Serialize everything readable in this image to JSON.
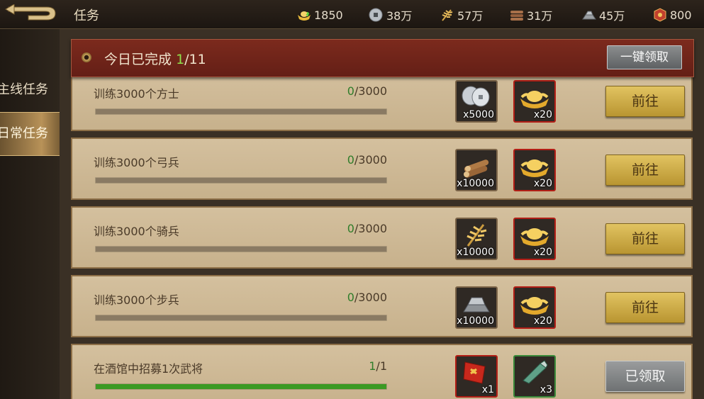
{
  "topbar": {
    "title": "任务",
    "resources": [
      {
        "icon": "gold-ingot-icon",
        "value": "1850"
      },
      {
        "icon": "silver-coin-icon",
        "value": "38万"
      },
      {
        "icon": "grain-icon",
        "value": "57万"
      },
      {
        "icon": "wood-icon",
        "value": "31万"
      },
      {
        "icon": "iron-icon",
        "value": "45万"
      },
      {
        "icon": "gem-chest-icon",
        "value": "800"
      }
    ]
  },
  "nav": {
    "main_tab": "主线任务",
    "daily_tab": "日常任务"
  },
  "summary": {
    "label": "今日已完成",
    "done": "1",
    "total": "/11",
    "claim_all": "一键领取"
  },
  "tasks": [
    {
      "name": "训练3000个方士",
      "cur": "0",
      "total": "/3000",
      "progress": 0,
      "rewards": [
        {
          "icon": "silver-coins-icon",
          "qty": "x5000"
        },
        {
          "icon": "gold-ingot-icon",
          "qty": "x20"
        }
      ],
      "button": "前往"
    },
    {
      "name": "训练3000个弓兵",
      "cur": "0",
      "total": "/3000",
      "progress": 0,
      "rewards": [
        {
          "icon": "wood-logs-icon",
          "qty": "x10000"
        },
        {
          "icon": "gold-ingot-icon",
          "qty": "x20"
        }
      ],
      "button": "前往"
    },
    {
      "name": "训练3000个骑兵",
      "cur": "0",
      "total": "/3000",
      "progress": 0,
      "rewards": [
        {
          "icon": "grain-icon",
          "qty": "x10000"
        },
        {
          "icon": "gold-ingot-icon",
          "qty": "x20"
        }
      ],
      "button": "前往"
    },
    {
      "name": "训练3000个步兵",
      "cur": "0",
      "total": "/3000",
      "progress": 0,
      "rewards": [
        {
          "icon": "iron-bars-icon",
          "qty": "x10000"
        },
        {
          "icon": "gold-ingot-icon",
          "qty": "x20"
        }
      ],
      "button": "前往"
    },
    {
      "name": "在酒馆中招募1次武将",
      "cur": "1",
      "total": "/1",
      "progress": 1,
      "rewards": [
        {
          "icon": "red-scroll-icon",
          "qty": "x1"
        },
        {
          "icon": "jade-token-icon",
          "qty": "x3"
        }
      ],
      "button": "已领取"
    }
  ],
  "colors": {
    "accent_gold": "#e1c361",
    "completed_green": "#8fe04a",
    "progress_green": "#3b9a24"
  }
}
